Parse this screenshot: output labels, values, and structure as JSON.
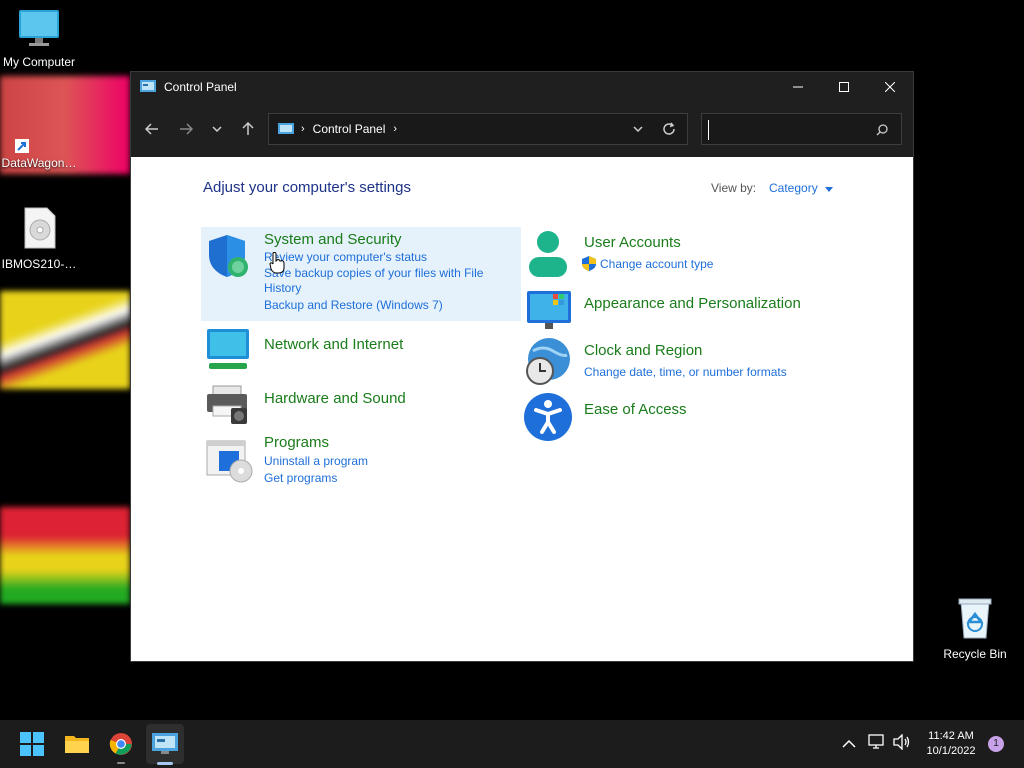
{
  "desktop": {
    "icons": [
      {
        "label": "My Computer",
        "icon": "monitor-icon"
      },
      {
        "label": "DataWagon…",
        "icon": "shortcut-icon"
      },
      {
        "label": "IBMOS210-…",
        "icon": "disc-image-icon"
      },
      {
        "label": "Recycle Bin",
        "icon": "recycle-bin-icon"
      }
    ]
  },
  "window": {
    "title": "Control Panel",
    "address": {
      "root_label": "Control Panel"
    },
    "search": {
      "placeholder": ""
    }
  },
  "content": {
    "heading": "Adjust your computer's settings",
    "view_by_label": "View by:",
    "view_by_value": "Category",
    "categories_left": [
      {
        "title": "System and Security",
        "links": [
          "Review your computer's status",
          "Save backup copies of your files with File",
          "History",
          "Backup and Restore (Windows 7)"
        ],
        "icon": "shield-icon"
      },
      {
        "title": "Network and Internet",
        "links": [],
        "icon": "network-icon"
      },
      {
        "title": "Hardware and Sound",
        "links": [],
        "icon": "printer-icon"
      },
      {
        "title": "Programs",
        "links": [
          "Uninstall a program",
          "Get programs"
        ],
        "icon": "programs-icon"
      }
    ],
    "categories_right": [
      {
        "title": "User Accounts",
        "links": [
          "Change account type"
        ],
        "icon": "user-icon"
      },
      {
        "title": "Appearance and Personalization",
        "links": [],
        "icon": "appearance-icon"
      },
      {
        "title": "Clock and Region",
        "links": [
          "Change date, time, or number formats"
        ],
        "icon": "clock-globe-icon"
      },
      {
        "title": "Ease of Access",
        "links": [],
        "icon": "accessibility-icon"
      }
    ]
  },
  "taskbar": {
    "clock_time": "11:42 AM",
    "clock_date": "10/1/2022",
    "notification_count": "1"
  },
  "colors": {
    "accent": "#1e6fd9",
    "category_title": "#1a7c1a",
    "heading": "#1e3287"
  }
}
